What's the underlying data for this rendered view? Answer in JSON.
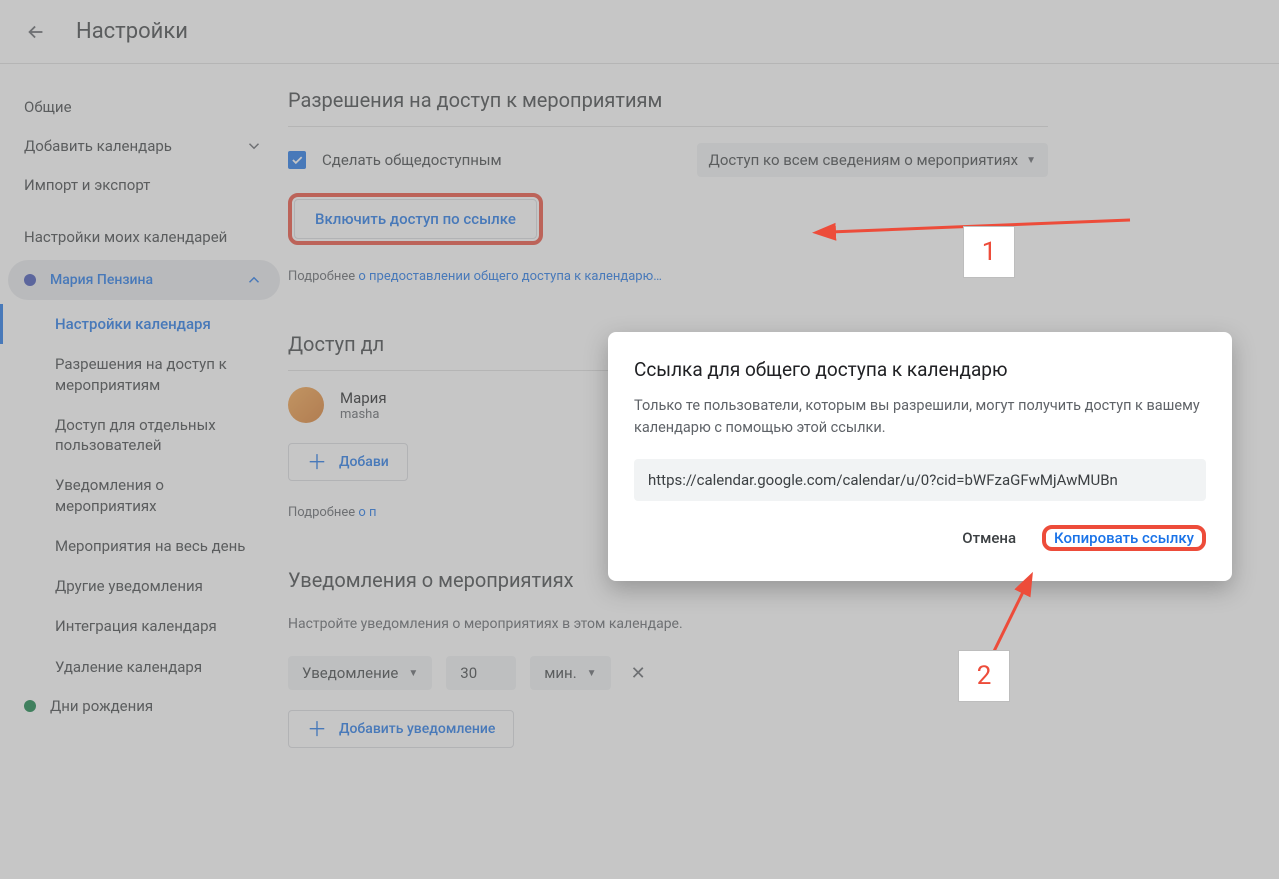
{
  "header": {
    "title": "Настройки"
  },
  "sidebar": {
    "items": [
      {
        "label": "Общие"
      },
      {
        "label": "Добавить календарь"
      },
      {
        "label": "Импорт и экспорт"
      }
    ],
    "my_calendars_title": "Настройки моих календарей",
    "active_calendar": {
      "name": "Мария Пензина",
      "color": "#3f51b5"
    },
    "sub_items": [
      "Настройки календаря",
      "Разрешения на доступ к мероприятиям",
      "Доступ для отдельных пользователей",
      "Уведомления о мероприятиях",
      "Мероприятия на весь день",
      "Другие уведомления",
      "Интеграция календаря",
      "Удаление календаря"
    ],
    "birthdays_label": "Дни рождения"
  },
  "permissions": {
    "title": "Разрешения на доступ к мероприятиям",
    "make_public_label": "Сделать общедоступным",
    "visibility_select": "Доступ ко всем сведениям о мероприятиях",
    "enable_link_button": "Включить доступ по ссылке",
    "more_prefix": "Подробнее ",
    "more_link": "о предоставлении общего доступа к календарю…"
  },
  "specific_access": {
    "title": "Доступ дл",
    "user_name": "Мария",
    "user_email": "masha",
    "add_people_button": "Добави",
    "more_prefix": "Подробнее ",
    "more_link": "о п"
  },
  "notifications": {
    "title": "Уведомления о мероприятиях",
    "desc": "Настройте уведомления о мероприятиях в этом календаре.",
    "type": "Уведомление",
    "value": "30",
    "unit": "мин.",
    "add_button": "Добавить уведомление"
  },
  "dialog": {
    "title": "Ссылка для общего доступа к календарю",
    "desc": "Только те пользователи, которым вы разрешили, могут получить доступ к вашему календарю с помощью этой ссылки.",
    "url": "https://calendar.google.com/calendar/u/0?cid=bWFzaGFwMjAwMUBn",
    "cancel": "Отмена",
    "copy": "Копировать ссылку"
  },
  "annotations": {
    "badge1": "1",
    "badge2": "2"
  }
}
